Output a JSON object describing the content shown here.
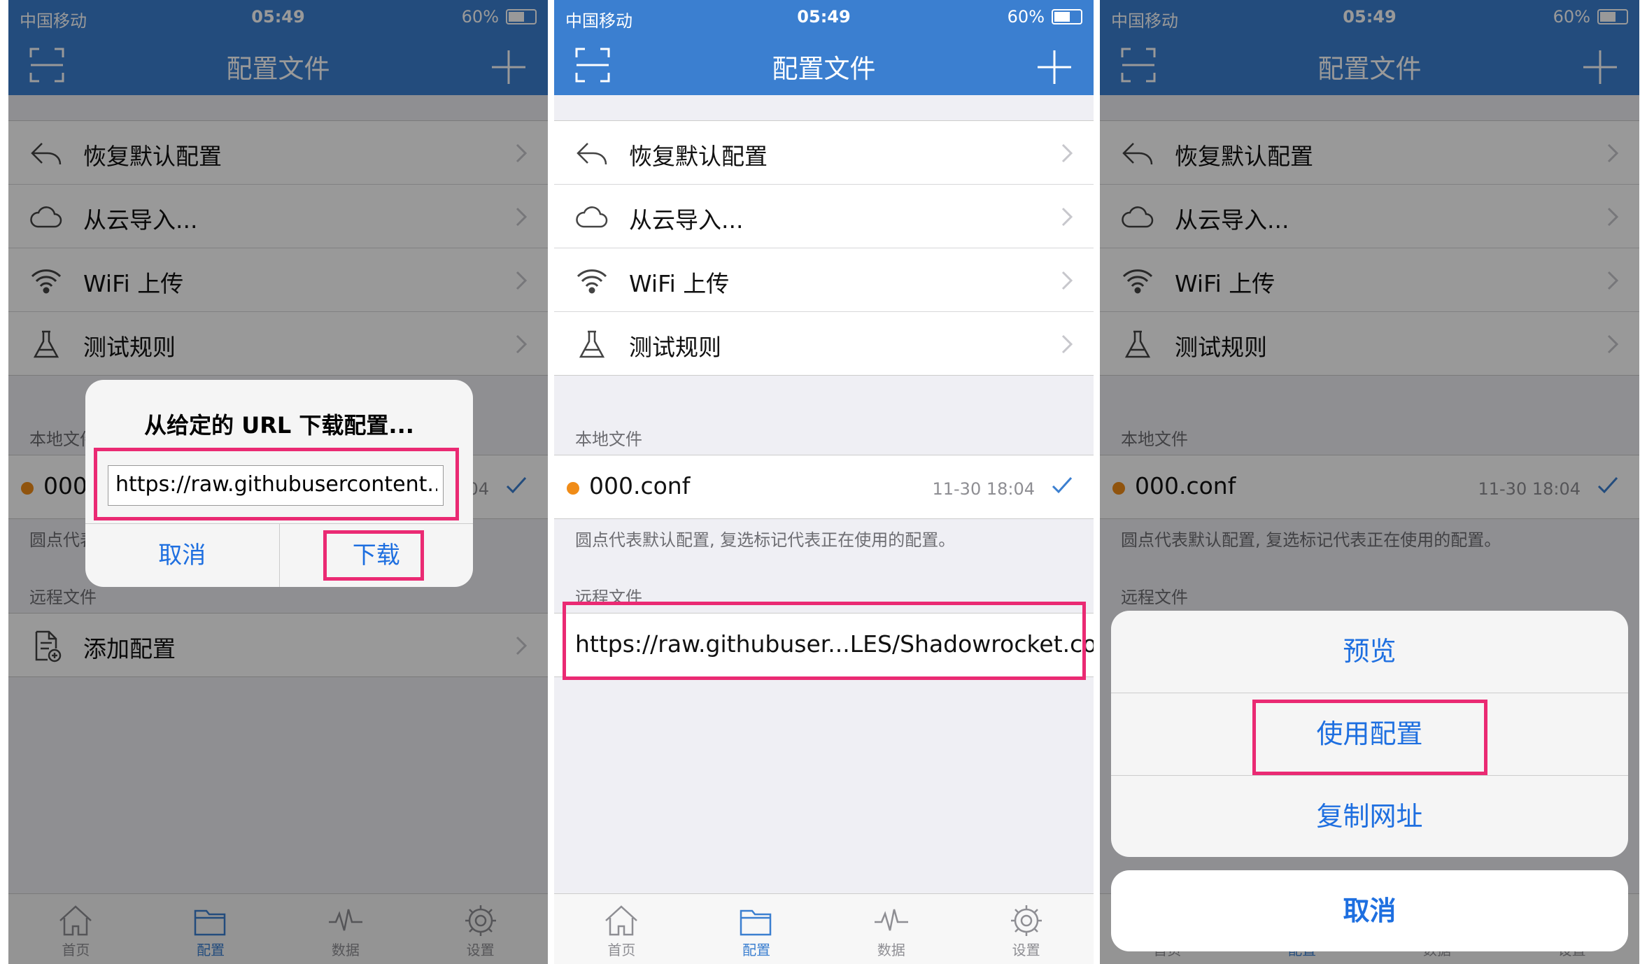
{
  "status": {
    "carrier": "中国移动",
    "time": "05:49",
    "battery": "60%"
  },
  "nav": {
    "title": "配置文件"
  },
  "menu": [
    {
      "label": "恢复默认配置",
      "icon": "reply-icon"
    },
    {
      "label": "从云导入...",
      "icon": "cloud-icon"
    },
    {
      "label": "WiFi 上传",
      "icon": "wifi-icon"
    },
    {
      "label": "测试规则",
      "icon": "flask-icon"
    }
  ],
  "local": {
    "header": "本地文件",
    "file": "000.conf",
    "date": "11-30 18:04",
    "note": "圆点代表默认配置, 复选标记代表正在使用的配置。"
  },
  "remote": {
    "header": "远程文件",
    "add": "添加配置",
    "url": "https://raw.githubuser...LES/Shadowrocket.conf"
  },
  "tabs": [
    {
      "label": "首页",
      "icon": "home-icon"
    },
    {
      "label": "配置",
      "icon": "folder-icon"
    },
    {
      "label": "数据",
      "icon": "pulse-icon"
    },
    {
      "label": "设置",
      "icon": "gear-icon"
    }
  ],
  "dialog": {
    "title": "从给定的 URL 下载配置...",
    "value": "https://raw.githubusercontent...",
    "cancel": "取消",
    "download": "下载"
  },
  "sheet": {
    "preview": "预览",
    "use": "使用配置",
    "copy": "复制网址",
    "cancel": "取消"
  },
  "colors": {
    "accent": "#3b7fd0",
    "highlight": "#ea2a73",
    "dot": "#f08c18",
    "button_text": "#1e6fe0"
  }
}
